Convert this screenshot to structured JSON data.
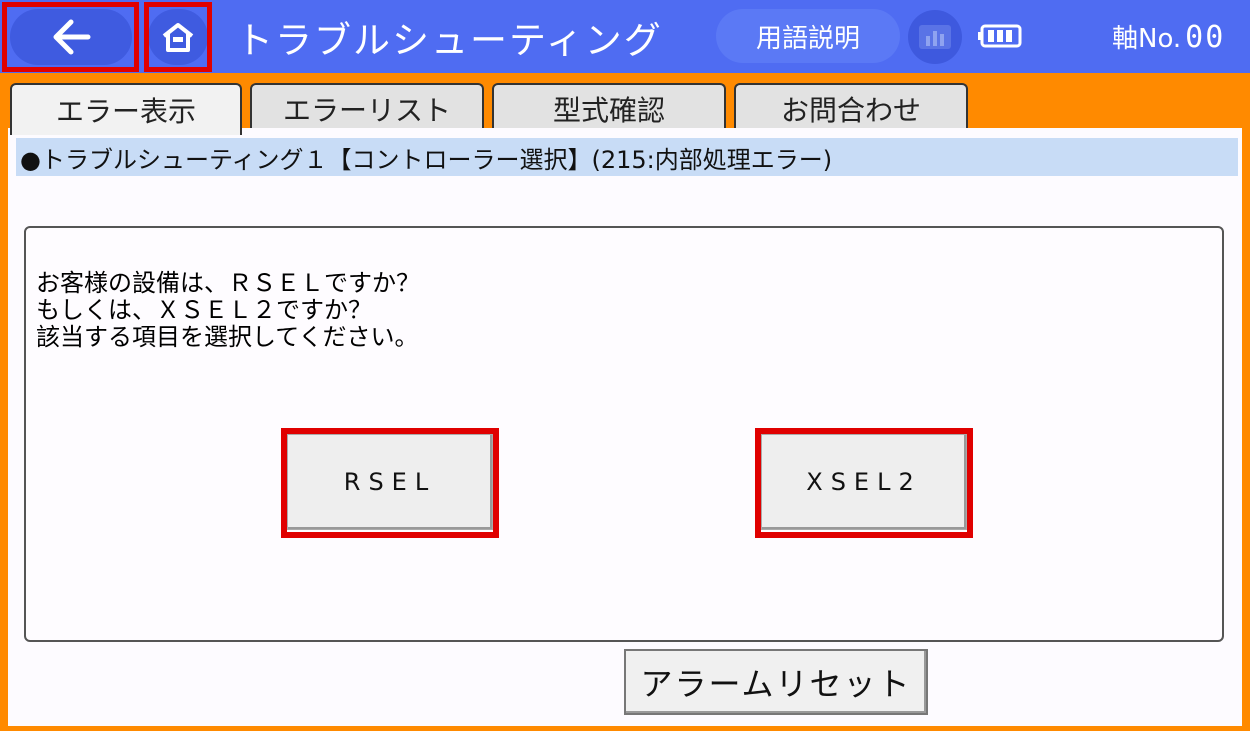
{
  "header": {
    "title": "トラブルシューティング",
    "glossary_label": "用語説明",
    "axis_label": "軸No.",
    "axis_value": "00"
  },
  "tabs": [
    {
      "label": "エラー表示",
      "active": true
    },
    {
      "label": "エラーリスト",
      "active": false
    },
    {
      "label": "型式確認",
      "active": false
    },
    {
      "label": "お問合わせ",
      "active": false
    }
  ],
  "breadcrumb": "●トラブルシューティング１【コントローラー選択】(215:内部処理エラー)",
  "question": {
    "line1": "お客様の設備は、ＲＳＥＬですか？",
    "line2": "もしくは、ＸＳＥＬ２ですか？",
    "line3": "該当する項目を選択してください。"
  },
  "choices": {
    "rsel": "RSEL",
    "xsel2": "XSEL2"
  },
  "alarm_reset_label": "アラームリセット",
  "colors": {
    "header_bg": "#4f6cf2",
    "frame_bg": "#ff8a00",
    "highlight": "#e00000",
    "breadcrumb_bg": "#c8dcf6"
  },
  "icons": [
    "back-arrow-icon",
    "home-icon",
    "chart-icon",
    "battery-icon"
  ]
}
